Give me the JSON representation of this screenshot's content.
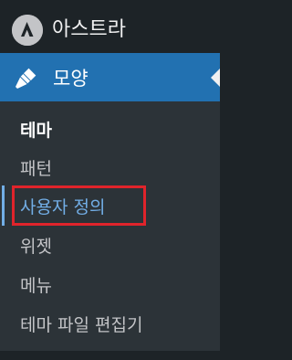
{
  "sidebar": {
    "top_item": {
      "label": "아스트라",
      "icon": "astra-logo-icon"
    },
    "current": {
      "label": "모양",
      "icon": "paintbrush-icon"
    },
    "submenu": [
      {
        "label": "테마",
        "state": "active"
      },
      {
        "label": "패턴",
        "state": "normal"
      },
      {
        "label": "사용자 정의",
        "state": "focused"
      },
      {
        "label": "위젯",
        "state": "normal"
      },
      {
        "label": "메뉴",
        "state": "normal"
      },
      {
        "label": "테마 파일 편집기",
        "state": "normal"
      }
    ]
  },
  "colors": {
    "sidebar_bg": "#1d2327",
    "submenu_bg": "#2c3338",
    "current_bg": "#2271b1",
    "focus_text": "#72aee6",
    "highlight_box": "#e0242b"
  }
}
